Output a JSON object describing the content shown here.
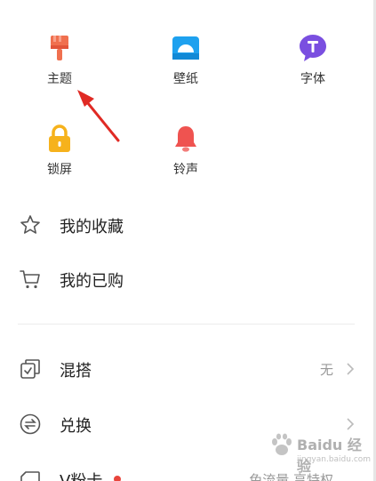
{
  "grid": {
    "theme_label": "主题",
    "wallpaper_label": "壁纸",
    "font_label": "字体",
    "lock_label": "锁屏",
    "ringtone_label": "铃声"
  },
  "menu": {
    "favorites_label": "我的收藏",
    "purchased_label": "我的已购",
    "mix_label": "混搭",
    "mix_value": "无",
    "exchange_label": "兑换",
    "vcard_label": "V粉卡",
    "vcard_value": "免流量 享特权"
  },
  "watermark": {
    "brand": "Baidu 经验",
    "url": "jingyan.baidu.com"
  },
  "colors": {
    "theme_icon": "#f0704f",
    "wallpaper_icon": "#1ea1ef",
    "font_icon": "#7a4fe0",
    "lock_icon": "#f6b21c",
    "ringtone_icon": "#ef5350",
    "arrow": "#e02a24",
    "red_dot": "#e8453c"
  },
  "icons": [
    "paint-brush-icon",
    "wallpaper-icon",
    "font-t-icon",
    "padlock-icon",
    "bell-icon",
    "star-icon",
    "cart-icon",
    "mix-icon",
    "exchange-icon",
    "card-icon",
    "chevron-right-icon"
  ]
}
